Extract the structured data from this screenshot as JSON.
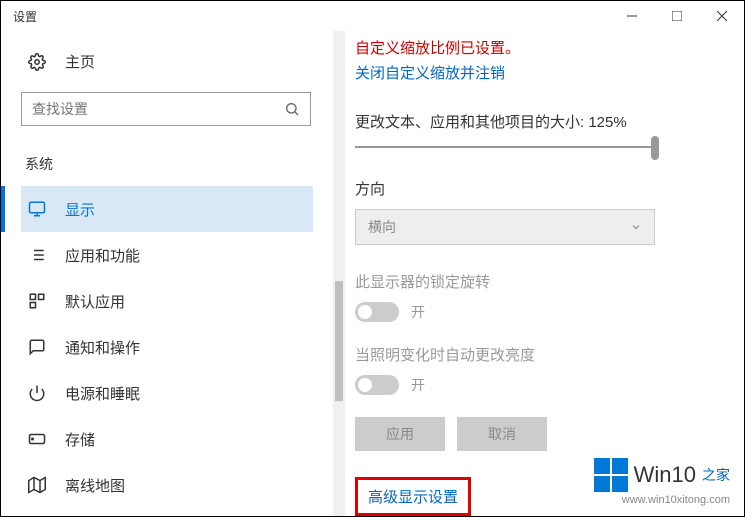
{
  "window": {
    "title": "设置"
  },
  "sidebar": {
    "home": "主页",
    "search_placeholder": "查找设置",
    "section": "系统",
    "items": [
      {
        "label": "显示"
      },
      {
        "label": "应用和功能"
      },
      {
        "label": "默认应用"
      },
      {
        "label": "通知和操作"
      },
      {
        "label": "电源和睡眠"
      },
      {
        "label": "存储"
      },
      {
        "label": "离线地图"
      }
    ]
  },
  "main": {
    "warning": "自定义缩放比例已设置。",
    "signout_link": "关闭自定义缩放并注销",
    "scale_label": "更改文本、应用和其他项目的大小: 125%",
    "orientation_label": "方向",
    "orientation_value": "横向",
    "lock_rotation_label": "此显示器的锁定旋转",
    "lock_rotation_state": "开",
    "brightness_label": "当照明变化时自动更改亮度",
    "brightness_state": "开",
    "apply_btn": "应用",
    "cancel_btn": "取消",
    "advanced_link": "高级显示设置"
  },
  "watermark": {
    "brand": "Win10",
    "suffix": "之家",
    "url": "www.win10xitong.com"
  }
}
